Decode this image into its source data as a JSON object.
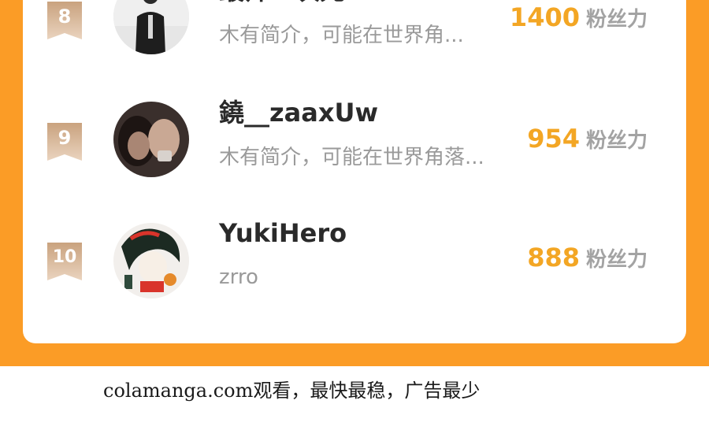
{
  "rows": [
    {
      "rank": "8",
      "name": "最帅二次元",
      "bio": "木有简介，可能在世界角...",
      "count": "1400",
      "unit": "粉丝力"
    },
    {
      "rank": "9",
      "name": "鐃__zaaxUw",
      "bio": "木有简介，可能在世界角落...",
      "count": "954",
      "unit": "粉丝力"
    },
    {
      "rank": "10",
      "name": "YukiHero",
      "bio": "zrro",
      "count": "888",
      "unit": "粉丝力"
    }
  ],
  "colors": {
    "frame": "#fb9c26",
    "count": "#f3a624",
    "badge": "#d8b494"
  },
  "watermark": "colamanga.com观看，最快最稳，广告最少"
}
